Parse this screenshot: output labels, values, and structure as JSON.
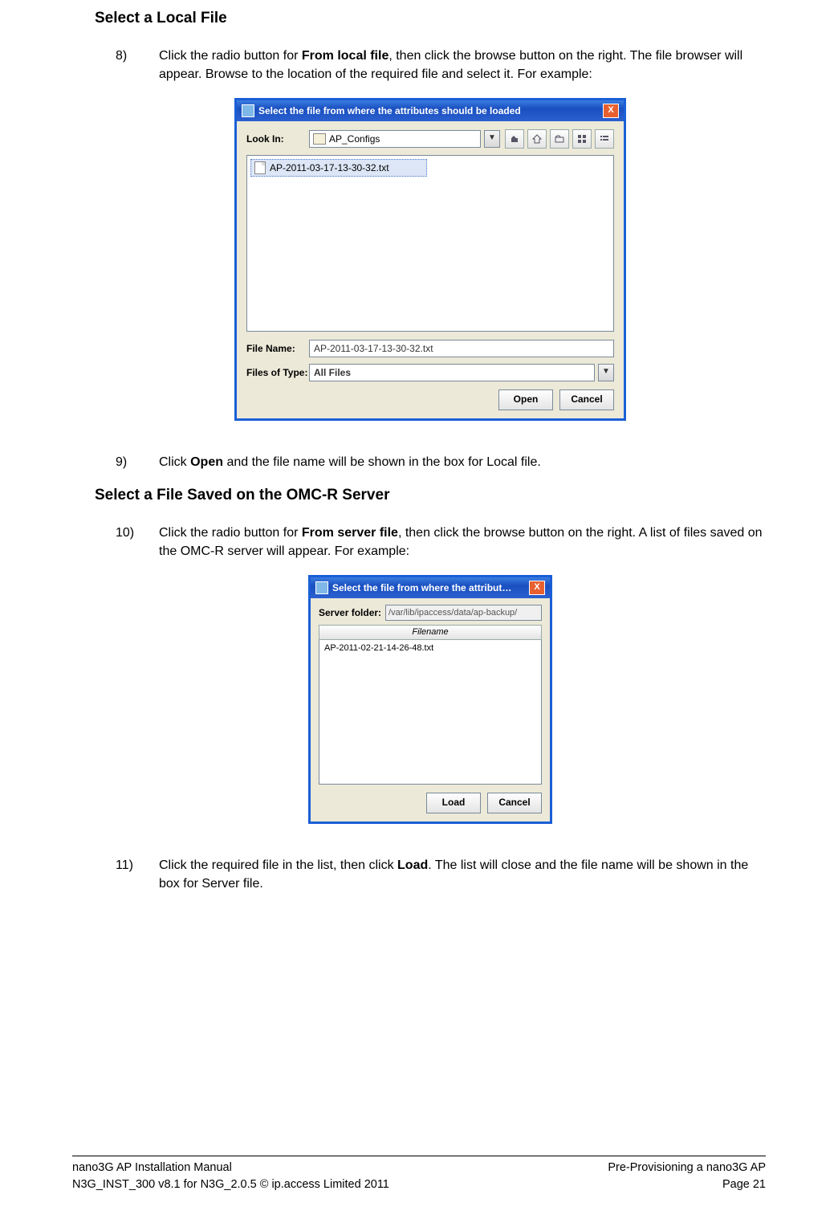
{
  "sections": {
    "s1_title": "Select a Local File",
    "s2_title": "Select a File Saved on the OMC-R Server"
  },
  "steps": {
    "n8": "8)",
    "n8_pre": "Click the radio button for ",
    "n8_bold": "From local file",
    "n8_post": ", then click the browse button on the right. The file browser will appear. Browse to the location of the required file and select it. For example:",
    "n9": "9)",
    "n9_pre": "Click ",
    "n9_bold": "Open",
    "n9_post": " and the file name will be shown in the box for Local file.",
    "n10": "10)",
    "n10_pre": "Click the radio button for ",
    "n10_bold": "From server file",
    "n10_post": ", then click the browse button on the right. A list of files saved on the OMC-R server will appear. For example:",
    "n11": "11)",
    "n11_pre": "Click the required file in the list, then click ",
    "n11_bold": "Load",
    "n11_post": ". The list will close and the file name will be shown in the box for Server file."
  },
  "dialog1": {
    "title": "Select the file from where the attributes should be loaded",
    "lookin_label": "Look In:",
    "lookin_value": "AP_Configs",
    "file_item": "AP-2011-03-17-13-30-32.txt",
    "filename_label": "File Name:",
    "filename_value": "AP-2011-03-17-13-30-32.txt",
    "type_label": "Files of Type:",
    "type_value": "All Files",
    "open_btn": "Open",
    "cancel_btn": "Cancel",
    "close_x": "X"
  },
  "dialog2": {
    "title": "Select the file from where the attribut…",
    "server_label": "Server folder:",
    "server_value": "/var/lib/ipaccess/data/ap-backup/",
    "col_header": "Filename",
    "row0": "AP-2011-02-21-14-26-48.txt",
    "load_btn": "Load",
    "cancel_btn": "Cancel",
    "close_x": "X"
  },
  "footer": {
    "left1": "nano3G AP Installation Manual",
    "left2": "N3G_INST_300 v8.1 for N3G_2.0.5 © ip.access Limited 2011",
    "right1": "Pre-Provisioning a nano3G AP",
    "right2": "Page 21"
  }
}
